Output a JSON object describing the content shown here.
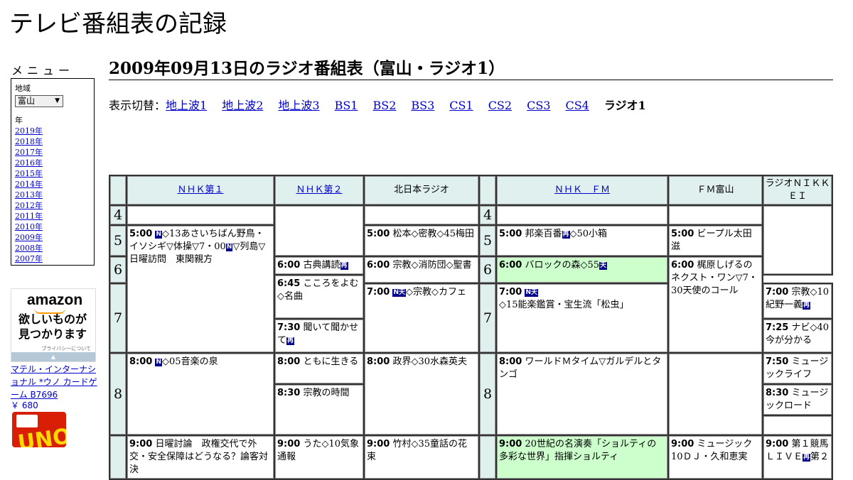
{
  "site_title": "テレビ番組表の記録",
  "menu": {
    "title": "メニュー",
    "region_label": "地域",
    "region_value": "富山",
    "year_label": "年",
    "years": [
      "2019年",
      "2018年",
      "2017年",
      "2016年",
      "2015年",
      "2014年",
      "2013年",
      "2012年",
      "2011年",
      "2010年",
      "2009年",
      "2008年",
      "2007年"
    ]
  },
  "ad": {
    "logo": "amazon",
    "tag1": "欲しいものが",
    "tag2": "見つかります",
    "privacy": "プライバシーについて",
    "product": "マテル・インターナショナル *ウノ カードゲーム B7696",
    "price": "￥ 680",
    "image_text": "UNO"
  },
  "page_title": "2009年09月13日のラジオ番組表（富山・ラジオ1）",
  "switcher": {
    "label": "表示切替：",
    "links": [
      "地上波1",
      "地上波2",
      "地上波3",
      "BS1",
      "BS2",
      "BS3",
      "CS1",
      "CS2",
      "CS3",
      "CS4"
    ],
    "current": "ラジオ1"
  },
  "channels": [
    "ＮＨＫ第１",
    "ＮＨＫ第２",
    "北日本ラジオ",
    "ＮＨＫ　ＦＭ",
    "ＦＭ富山",
    "ラジオＮＩＫＫＥＩ"
  ],
  "hours": [
    "4",
    "5",
    "6",
    "7",
    "8"
  ],
  "programs": {
    "nhk1": [
      {
        "time": "5:00",
        "badge": "N",
        "text": "◇13あさいちばん野鳥・イソシギ▽体操▽7・00",
        "badge2": "N",
        "text2": "▽列島▽日曜訪問　東関親方"
      },
      {
        "time": "8:00",
        "badge": "N",
        "text": "◇05音楽の泉"
      },
      {
        "time": "9:00",
        "text": "日曜討論　政権交代で外交・安全保障はどうなる？論客対決"
      }
    ],
    "nhk2": [
      {
        "time": "6:00",
        "text": "古典講読",
        "badge": "再"
      },
      {
        "time": "6:45",
        "text": "こころをよむ◇名曲"
      },
      {
        "time": "7:30",
        "text": "聞いて聞かせて",
        "badge": "再"
      },
      {
        "time": "8:00",
        "text": "ともに生きる"
      },
      {
        "time": "8:30",
        "text": "宗教の時間"
      },
      {
        "time": "9:00",
        "text": "うた◇10気象通報"
      }
    ],
    "kitanihon": [
      {
        "time": "5:00",
        "text": "松本◇密教◇45梅田"
      },
      {
        "time": "6:00",
        "text": "宗教◇消防団◇聖書"
      },
      {
        "time": "7:00",
        "badge": "N天",
        "text": "◇宗教◇カフェ"
      },
      {
        "time": "8:00",
        "text": "政界◇30水森英夫"
      },
      {
        "time": "9:00",
        "text": "竹村◇35童話の花束"
      }
    ],
    "nhkfm": [
      {
        "time": "5:00",
        "text": "邦楽百番",
        "badge": "再",
        "text2": "◇50小箱"
      },
      {
        "time": "6:00",
        "text": "バロックの森◇55",
        "badge": "天"
      },
      {
        "time": "7:00",
        "badge": "N天",
        "text": "◇15能楽鑑賞・宝生流「松虫」"
      },
      {
        "time": "8:00",
        "text": "ワールドＭタイム▽ガルデルとタンゴ"
      },
      {
        "time": "9:00",
        "text": "20世紀の名演奏「ショルティの多彩な世界」指揮ショルティ"
      }
    ],
    "fmtoyama": [
      {
        "time": "5:00",
        "text": "ビープル太田滋"
      },
      {
        "time": "6:00",
        "text": "梶原しげるのネクスト・ワン▽7・30天使のコール"
      },
      {
        "time": "9:00",
        "text": "ミュージック10ＤＪ・久和恵実"
      }
    ],
    "nikkei": [
      {
        "time": "7:00",
        "text": "宗教◇10紀野一義",
        "badge": "再"
      },
      {
        "time": "7:25",
        "text": "ナビ◇40今が分かる"
      },
      {
        "time": "7:50",
        "text": "ミュージックライフ"
      },
      {
        "time": "8:30",
        "text": "ミュージックロード"
      },
      {
        "time": "9:00",
        "text": "第１競馬ＬＩＶＥ",
        "badge": "再",
        "text2": "第２"
      }
    ]
  }
}
